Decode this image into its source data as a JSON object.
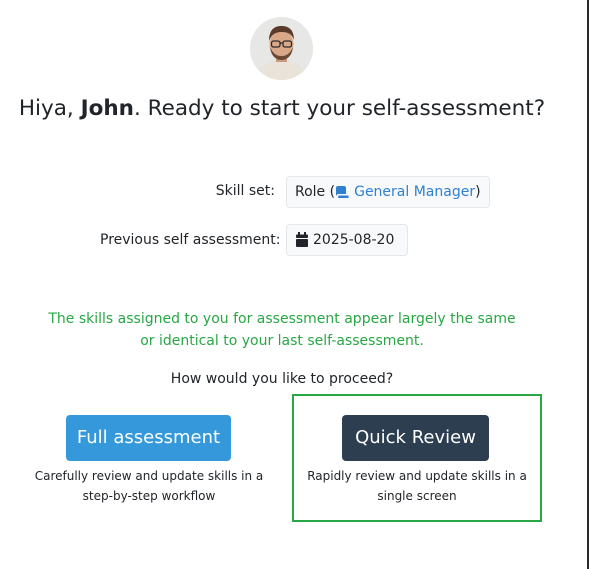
{
  "greeting": {
    "prefix": "Hiya,",
    "name": "John",
    "suffix": ". Ready to start your self-assessment?"
  },
  "skill_set": {
    "label": "Skill set:",
    "prefix": "Role (",
    "role_icon": "role-icon",
    "role_link": "General Manager",
    "suffix": ")"
  },
  "previous": {
    "label": "Previous self assessment:",
    "calendar_icon": "calendar-icon",
    "date": "2025-08-20"
  },
  "notice": "The skills assigned to you for assessment appear largely the same or identical to your last self-assessment.",
  "question": "How would you like to proceed?",
  "options": {
    "full": {
      "label": "Full assessment",
      "description": "Carefully review and update skills in a step-by-step workflow",
      "color": "#3498db"
    },
    "quick": {
      "label": "Quick Review",
      "description": "Rapidly review and update skills in a single screen",
      "color": "#2c3e50"
    }
  },
  "colors": {
    "notice": "#28a745",
    "link": "#2f80d1",
    "highlight": "#2aa745"
  }
}
